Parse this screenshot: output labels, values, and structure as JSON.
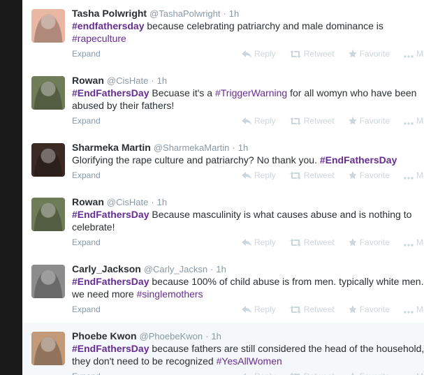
{
  "actions": {
    "expand": "Expand",
    "reply": "Reply",
    "retweet": "Retweet",
    "favorite": "Favorite",
    "more": "More"
  },
  "avatar_colors": [
    "#e9b7a3",
    "#6e7c57",
    "#3b2a24",
    "#6e7c57",
    "#8c8c8c",
    "#c29a7a"
  ],
  "tweets": [
    {
      "name": "Tasha Polwright",
      "handle": "@TashaPolwright",
      "dot": "·",
      "time": "1h",
      "segments": [
        {
          "t": "#endfathersday",
          "tag": true
        },
        {
          "t": " because celebrating patriarchy and male dominance is ",
          "tag": false
        },
        {
          "t": "#rapeculture",
          "tag": true,
          "plain": true
        }
      ]
    },
    {
      "name": "Rowan",
      "handle": "@CisHate",
      "dot": "·",
      "time": "1h",
      "segments": [
        {
          "t": "#EndFathersDay",
          "tag": true
        },
        {
          "t": " Becuase it's a ",
          "tag": false
        },
        {
          "t": "#TriggerWarning",
          "tag": true,
          "plain": true
        },
        {
          "t": " for all womyn who have been abused by their fathers!",
          "tag": false
        }
      ]
    },
    {
      "name": "Sharmeka Martin",
      "handle": "@SharmekaMartin",
      "dot": "·",
      "time": "1h",
      "segments": [
        {
          "t": "Glorifying the rape culture and patriarchy? No thank you. ",
          "tag": false
        },
        {
          "t": "#EndFathersDay",
          "tag": true
        }
      ]
    },
    {
      "name": "Rowan",
      "handle": "@CisHate",
      "dot": "·",
      "time": "1h",
      "segments": [
        {
          "t": "#EndFathersDay",
          "tag": true
        },
        {
          "t": " Because masculinity is what causes abuse and is nothing to celebrate!",
          "tag": false
        }
      ]
    },
    {
      "name": "Carly_Jackson",
      "handle": "@Carly_Jacksn",
      "dot": "·",
      "time": "1h",
      "segments": [
        {
          "t": "#EndFathersDay",
          "tag": true
        },
        {
          "t": " because 100% of child abuse is from men. typically white men. we need more ",
          "tag": false
        },
        {
          "t": "#singlemothers",
          "tag": true,
          "plain": true
        }
      ]
    },
    {
      "name": "Phoebe Kwon",
      "handle": "@PhoebeKwon",
      "dot": "·",
      "time": "1h",
      "segments": [
        {
          "t": "#EndFathersDay",
          "tag": true
        },
        {
          "t": " because fathers are still considered the head of the household, they don't need to be recognized ",
          "tag": false
        },
        {
          "t": "#YesAllWomen",
          "tag": true,
          "plain": true
        }
      ]
    }
  ]
}
